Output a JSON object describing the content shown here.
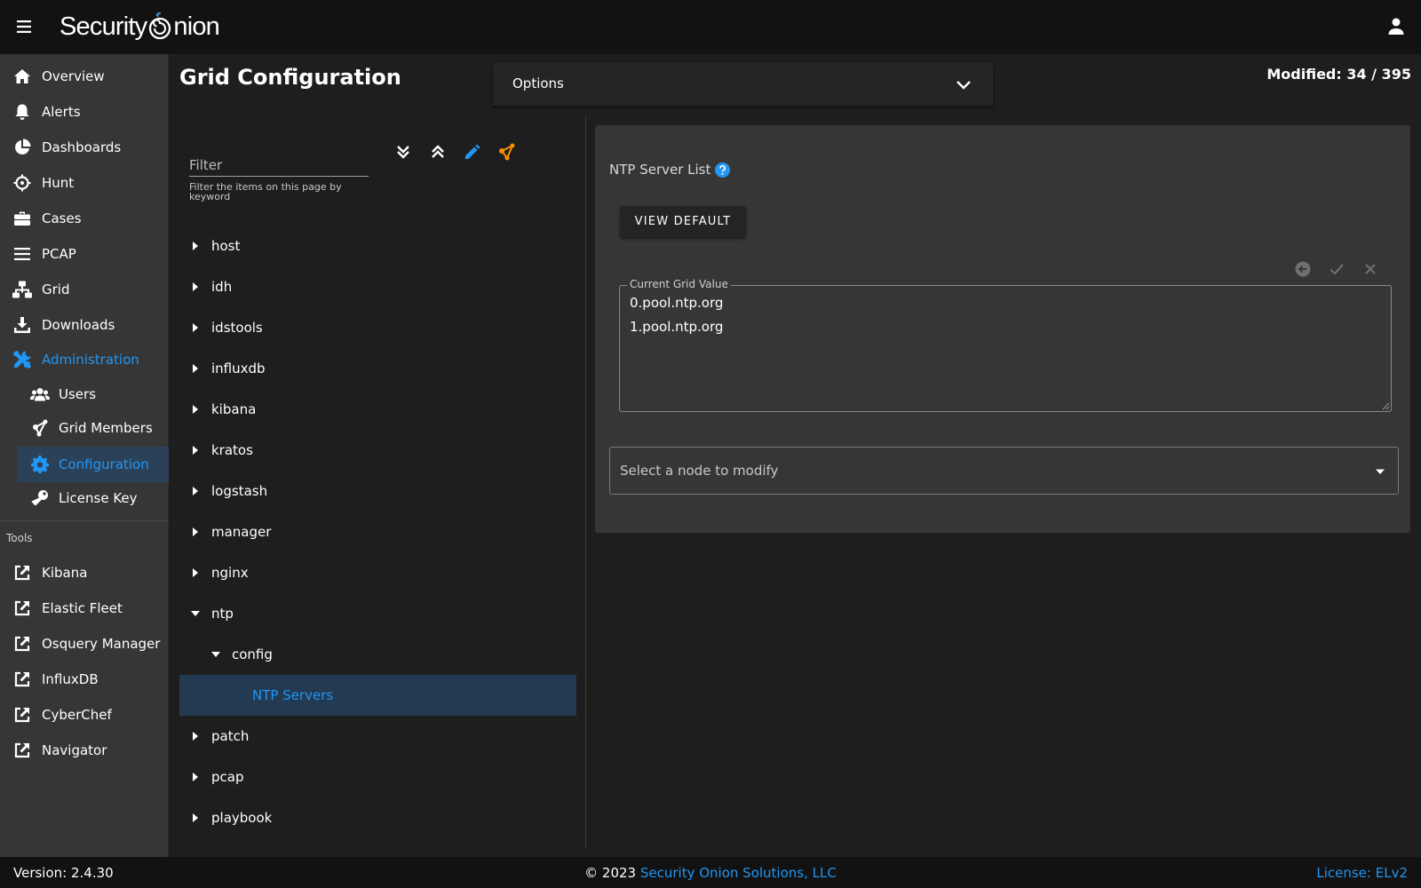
{
  "appbar": {
    "logo_text_left": "Security",
    "logo_text_right": "nion",
    "menu_icon": "hamburger-menu-icon",
    "user_icon": "account-icon"
  },
  "sidebar": {
    "items": [
      {
        "label": "Overview",
        "icon": "home-icon"
      },
      {
        "label": "Alerts",
        "icon": "bell-icon"
      },
      {
        "label": "Dashboards",
        "icon": "pie-chart-icon"
      },
      {
        "label": "Hunt",
        "icon": "crosshairs-icon"
      },
      {
        "label": "Cases",
        "icon": "briefcase-icon"
      },
      {
        "label": "PCAP",
        "icon": "list-icon"
      },
      {
        "label": "Grid",
        "icon": "network-icon"
      },
      {
        "label": "Downloads",
        "icon": "download-icon"
      },
      {
        "label": "Administration",
        "icon": "tools-icon"
      }
    ],
    "admin_items": [
      {
        "label": "Users",
        "icon": "users-icon"
      },
      {
        "label": "Grid Members",
        "icon": "nodes-icon"
      },
      {
        "label": "Configuration",
        "icon": "gear-icon"
      },
      {
        "label": "License Key",
        "icon": "key-icon"
      }
    ],
    "tools_label": "Tools",
    "tools": [
      {
        "label": "Kibana",
        "icon": "external-link-icon"
      },
      {
        "label": "Elastic Fleet",
        "icon": "external-link-icon"
      },
      {
        "label": "Osquery Manager",
        "icon": "external-link-icon"
      },
      {
        "label": "InfluxDB",
        "icon": "external-link-icon"
      },
      {
        "label": "CyberChef",
        "icon": "external-link-icon"
      },
      {
        "label": "Navigator",
        "icon": "external-link-icon"
      }
    ]
  },
  "main": {
    "title": "Grid Configuration",
    "options_label": "Options",
    "modified": "Modified: 34 / 395",
    "filter": {
      "placeholder": "Filter",
      "hint": "Filter the items on this page by keyword"
    },
    "toolbar_icons": [
      "expand-all-icon",
      "collapse-all-icon",
      "pencil-icon",
      "nodes-icon"
    ],
    "tree": [
      {
        "label": "host",
        "expanded": false,
        "level": 0
      },
      {
        "label": "idh",
        "expanded": false,
        "level": 0
      },
      {
        "label": "idstools",
        "expanded": false,
        "level": 0
      },
      {
        "label": "influxdb",
        "expanded": false,
        "level": 0
      },
      {
        "label": "kibana",
        "expanded": false,
        "level": 0
      },
      {
        "label": "kratos",
        "expanded": false,
        "level": 0
      },
      {
        "label": "logstash",
        "expanded": false,
        "level": 0
      },
      {
        "label": "manager",
        "expanded": false,
        "level": 0
      },
      {
        "label": "nginx",
        "expanded": false,
        "level": 0
      },
      {
        "label": "ntp",
        "expanded": true,
        "level": 0
      },
      {
        "label": "config",
        "expanded": true,
        "level": 1
      },
      {
        "label": "NTP Servers",
        "leaf": true,
        "level": 2,
        "selected": true
      },
      {
        "label": "patch",
        "expanded": false,
        "level": 0
      },
      {
        "label": "pcap",
        "expanded": false,
        "level": 0
      },
      {
        "label": "playbook",
        "expanded": false,
        "level": 0
      }
    ],
    "detail": {
      "setting_title": "NTP Server List",
      "view_default_label": "VIEW DEFAULT",
      "current_value_legend": "Current Grid Value",
      "current_value": "0.pool.ntp.org\n1.pool.ntp.org",
      "node_select_placeholder": "Select a node to modify"
    }
  },
  "footer": {
    "version": "Version: 2.4.30",
    "copyright_prefix": "© 2023 ",
    "copyright_link": "Security Onion Solutions, LLC",
    "license": "License: ELv2"
  },
  "colors": {
    "accent": "#2196f3",
    "orange": "#ff8f00",
    "appbar": "#121212",
    "sidebar": "#363636",
    "background": "#1e1e1e",
    "selected": "#233a52"
  }
}
